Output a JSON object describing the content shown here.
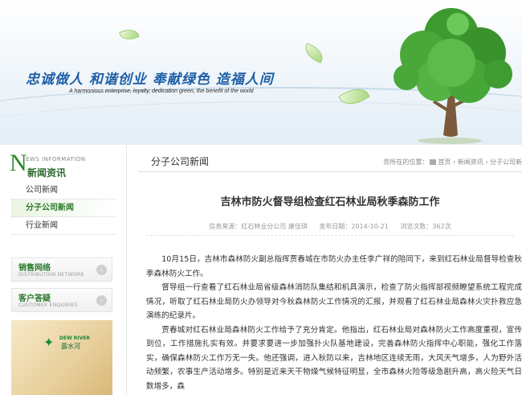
{
  "banner": {
    "slogan": "忠诚做人 和谐创业 奉献绿色 造福人间",
    "slogan_en": "A harmonious enterprise, loyalty, dedication green, the benefit of the world"
  },
  "sidebar": {
    "news_initial": "N",
    "news_en": "EWS INFORMATION",
    "news_cn": "新闻资讯",
    "items": [
      {
        "label": "公司新闻"
      },
      {
        "label": "分子公司新闻"
      },
      {
        "label": "行业新闻"
      }
    ],
    "sales": {
      "cn": "销售网络",
      "en": "DISTRIBUTION NETWORK"
    },
    "enquiry": {
      "cn": "客户答疑",
      "en": "CUSTOMER ENQUIRIES"
    },
    "ad": {
      "logo_en": "DEW RIVER",
      "logo_cn": "露水河"
    }
  },
  "main": {
    "title": "分子公司新闻",
    "breadcrumb": {
      "prefix": "您所在的位置：",
      "home": "首页",
      "sep": "›",
      "level1": "新闻资讯",
      "level2": "分子公司新"
    },
    "article": {
      "title": "吉林市防火督导组检查红石林业局秋季森防工作",
      "source": "信息来源：红石林业分公司 康佳琪",
      "date": "发布日期：2014-10-21",
      "views": "浏览次数：362次",
      "paragraphs": [
        "10月15日，吉林市森林防火副总指挥贾春城在市防火办主任李广祥的陪同下，来到红石林业局督导检查秋季森林防火工作。",
        "督导组一行查看了红石林业局省级森林消防队集结和机具演示，检查了防火指挥部视频瞭望系统工程完成情况，听取了红石林业局防火办领导对今秋森林防火工作情况的汇报，并观看了红石林业局森林火灾扑救应急演练的纪录片。",
        "贾春城对红石林业局森林防火工作给予了充分肯定。他指出，红石林业局对森林防火工作高度重视，宣传到位，工作措施扎实有效。并要求要进一步加强扑火队基地建设，完善森林防火指挥中心职能，强化工作落实，确保森林防火工作万无一失。他还强调，进入秋防以来，吉林地区连续无雨，大风天气增多，人为野外活动频繁，农事生产活动增多。特别是近来天干物燥气候特征明显，全市森林火险等级急剧升高，高火险天气日数增多，森"
      ]
    }
  },
  "colors": {
    "brand_green": "#2c7a2c",
    "slogan_blue": "#1f5fa6"
  }
}
